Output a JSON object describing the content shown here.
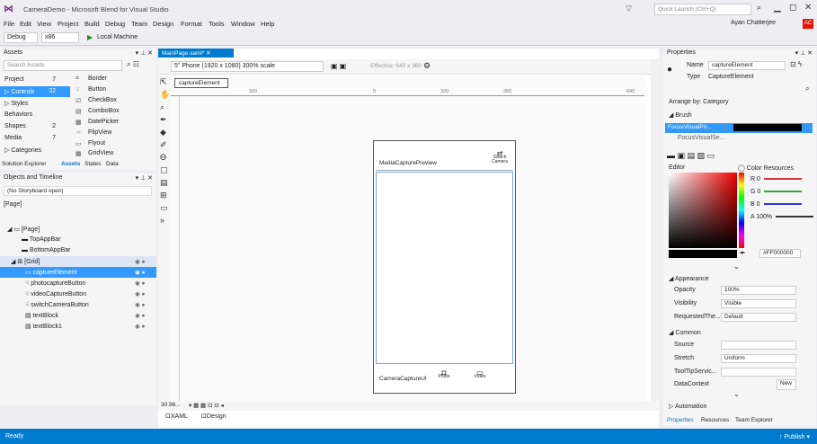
{
  "window": {
    "title": "CameraDemo - Microsoft Blend for Visual Studio",
    "filter_icon": "filter-icon",
    "quick_launch": "Quick Launch (Ctrl+Q)",
    "minimize": "▁",
    "restore": "◻",
    "close": "✕"
  },
  "menu": [
    "File",
    "Edit",
    "View",
    "Project",
    "Build",
    "Debug",
    "Team",
    "Design",
    "Format",
    "Tools",
    "Window",
    "Help"
  ],
  "user": {
    "name": "Ayan Chatterjee",
    "initials": "AC"
  },
  "toolbar": {
    "config": "Debug",
    "platform": "x86",
    "run": "▶",
    "target": "Local Machine"
  },
  "assets": {
    "header": "Assets",
    "search_placeholder": "Search Assets",
    "categories": [
      {
        "label": "Project",
        "count": "7"
      },
      {
        "label": "Controls",
        "count": "32"
      },
      {
        "label": "Styles",
        "count": ""
      },
      {
        "label": "Behaviors",
        "count": ""
      },
      {
        "label": "Shapes",
        "count": "2"
      },
      {
        "label": "Media",
        "count": "7"
      },
      {
        "label": "Categories",
        "count": ""
      }
    ],
    "items": [
      "Border",
      "Button",
      "CheckBox",
      "ComboBox",
      "DatePicker",
      "FlipView",
      "Flyout",
      "GridView"
    ],
    "tabs": [
      "Solution Explorer",
      "Assets",
      "States",
      "Data"
    ]
  },
  "objects": {
    "header": "Objects and Timeline",
    "storyboard": "(No Storyboard open)",
    "page_label": "[Page]",
    "tree": [
      "[Page]",
      "TopAppBar",
      "BottomAppBar",
      "[Grid]",
      "captureElement",
      "photocaptureButton",
      "videoCaptureButton",
      "switchCameraButton",
      "textBlock",
      "textBlock1"
    ]
  },
  "editor": {
    "doc_tab": "MainPage.xaml*",
    "device": "5\" Phone (1920 x 1080) 300% scale",
    "effective": "Effective: 640 x 360",
    "breadcrumb": "captureElement",
    "ruler": [
      "320",
      "0",
      "360",
      "320",
      "640"
    ],
    "mcp_label": "MediaCapturePreview",
    "switch_label": "Switch Camera",
    "ccu_label": "CameraCaptureUI",
    "photo_label": "Photo",
    "video_label": "Video",
    "zoom": "30.96...",
    "tabs": [
      "XAML",
      "Design"
    ]
  },
  "properties": {
    "header": "Properties",
    "name_label": "Name",
    "name_value": "captureElement",
    "type_label": "Type",
    "type_value": "CaptureElement",
    "arrange": "Arrange by: Category",
    "brush_section": "Brush",
    "brush_rows": [
      "FocusVisualPri...",
      "FocusVisualSe..."
    ],
    "editor_label": "Editor",
    "color_res": "Color Resources",
    "r": "0",
    "g": "0",
    "b": "0",
    "a": "100%",
    "hex": "#FF000000",
    "appearance": "Appearance",
    "opacity_label": "Opacity",
    "opacity": "100%",
    "visibility_label": "Visibility",
    "visibility": "Visible",
    "req_label": "RequestedThe...",
    "req": "Default",
    "common": "Common",
    "source_label": "Source",
    "stretch_label": "Stretch",
    "stretch": "Uniform",
    "tooltip_label": "ToolTipServic...",
    "datacontext_label": "DataContext",
    "new_btn": "New",
    "automation": "Automation",
    "tabs": [
      "Properties",
      "Resources",
      "Team Explorer"
    ]
  },
  "status": {
    "text": "Ready",
    "publish": "Publish"
  },
  "colors": {
    "accent": "#007acc",
    "selection": "#3399ff",
    "avatar": "#e51400"
  }
}
